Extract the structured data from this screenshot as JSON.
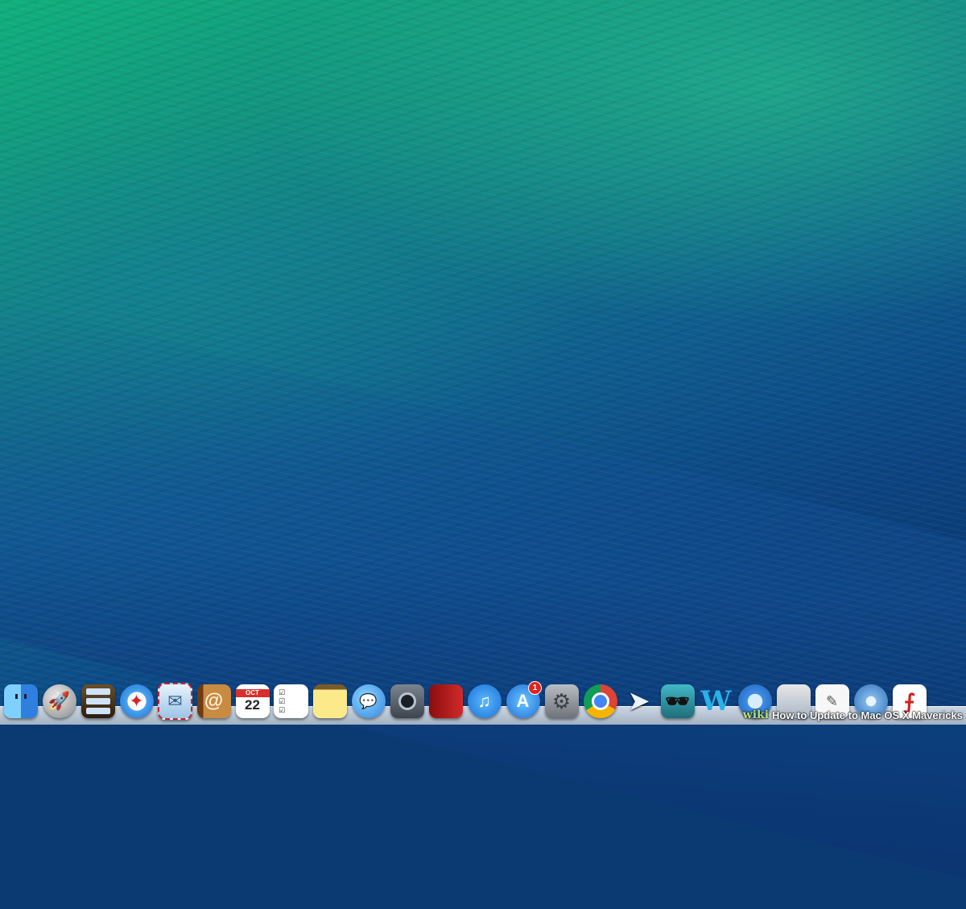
{
  "dock": {
    "items": [
      {
        "name": "Finder",
        "glyph": ""
      },
      {
        "name": "Launchpad",
        "glyph": "🚀"
      },
      {
        "name": "Mission Control",
        "glyph": ""
      },
      {
        "name": "Safari",
        "glyph": "✦"
      },
      {
        "name": "Mail",
        "glyph": "✉"
      },
      {
        "name": "Contacts",
        "glyph": "@"
      },
      {
        "name": "Calendar",
        "month": "OCT",
        "day": "22"
      },
      {
        "name": "Reminders",
        "glyph": "☑"
      },
      {
        "name": "Notes",
        "glyph": ""
      },
      {
        "name": "Messages",
        "glyph": "💬"
      },
      {
        "name": "FaceTime",
        "glyph": ""
      },
      {
        "name": "Photo Booth",
        "glyph": ""
      },
      {
        "name": "iTunes",
        "glyph": "♫"
      },
      {
        "name": "App Store",
        "glyph": "A",
        "badge": "1"
      },
      {
        "name": "System Preferences",
        "glyph": "⚙"
      },
      {
        "name": "Google Chrome",
        "glyph": ""
      },
      {
        "name": "Paper Plane",
        "glyph": "➤"
      },
      {
        "name": "Spy",
        "glyph": "🕶"
      },
      {
        "name": "W App",
        "glyph": "W"
      },
      {
        "name": "QuickTime",
        "glyph": ""
      },
      {
        "name": "Preview",
        "glyph": ""
      },
      {
        "name": "TextEdit",
        "glyph": "✎"
      },
      {
        "name": "DVD Player",
        "glyph": ""
      },
      {
        "name": "Adobe Reader",
        "glyph": "⨍"
      }
    ]
  },
  "watermark": {
    "logo": "wiki",
    "text": "How to Update to Mac OS X Mavericks"
  }
}
